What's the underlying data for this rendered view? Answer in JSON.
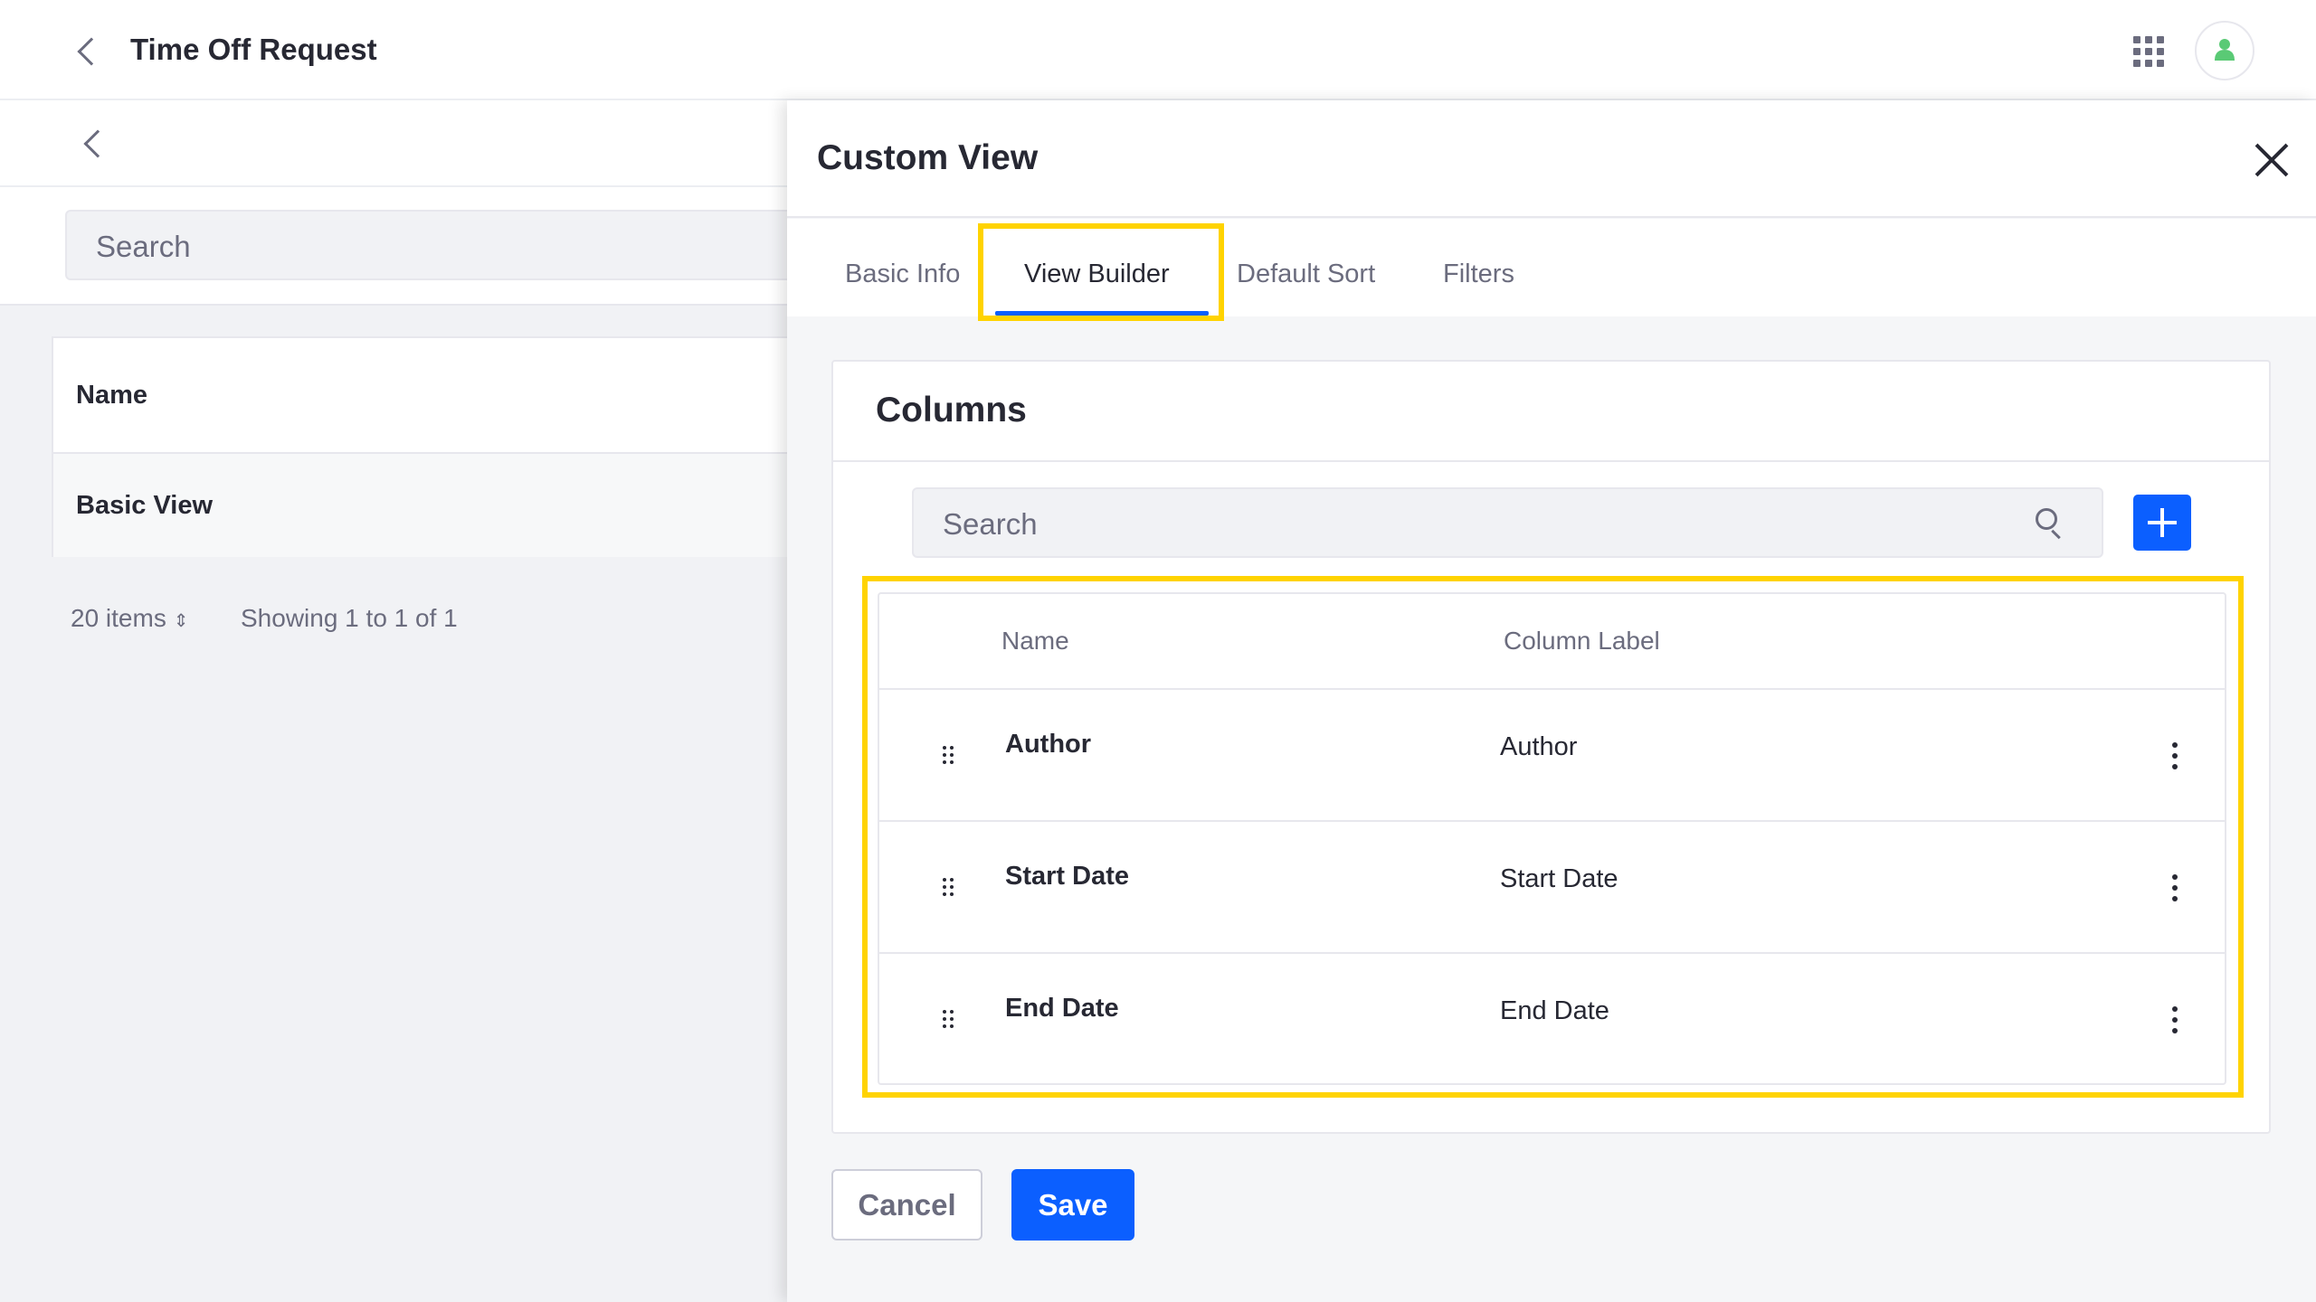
{
  "header": {
    "title": "Time Off Request",
    "back_icon": "chevron-left-icon",
    "apps_icon": "grid-icon",
    "avatar_icon": "user-icon"
  },
  "left_panel": {
    "search_placeholder": "Search",
    "table_header": "Name",
    "rows": [
      "Basic View"
    ],
    "items_per_page": "20 items",
    "showing": "Showing 1 to 1 of 1"
  },
  "modal": {
    "title": "Custom View",
    "tabs": [
      {
        "label": "Basic Info"
      },
      {
        "label": "View Builder",
        "active": true
      },
      {
        "label": "Default Sort"
      },
      {
        "label": "Filters"
      }
    ],
    "columns": {
      "title": "Columns",
      "search_placeholder": "Search",
      "headers": [
        "Name",
        "Column Label"
      ],
      "rows": [
        {
          "name": "Author",
          "label": "Author"
        },
        {
          "name": "Start Date",
          "label": "Start Date"
        },
        {
          "name": "End Date",
          "label": "End Date"
        }
      ]
    },
    "cancel_label": "Cancel",
    "save_label": "Save"
  },
  "colors": {
    "accent": "#0b5fff",
    "highlight": "#ffd300",
    "avatar": "#5aca75"
  }
}
